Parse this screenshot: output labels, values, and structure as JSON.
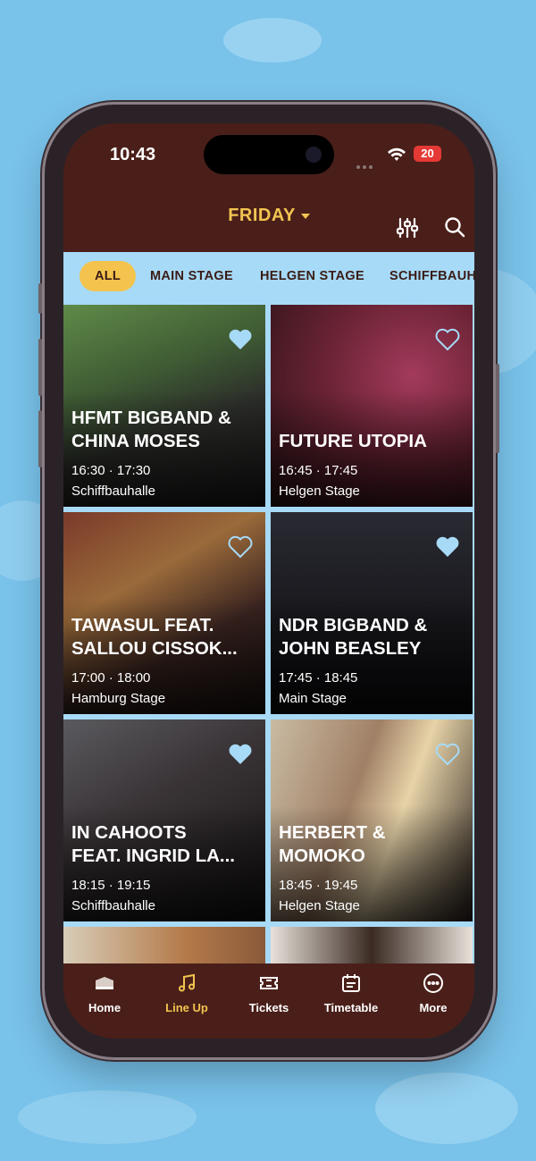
{
  "status": {
    "time": "10:43",
    "battery": "20"
  },
  "header": {
    "day": "FRIDAY"
  },
  "tabs": [
    {
      "label": "ALL",
      "active": true
    },
    {
      "label": "MAIN STAGE",
      "active": false
    },
    {
      "label": "HELGEN STAGE",
      "active": false
    },
    {
      "label": "SCHIFFBAUHALLE",
      "active": false
    }
  ],
  "events": [
    {
      "title": "HFMT BIGBAND &\nCHINA MOSES",
      "times": "16:30 · 17:30",
      "stage": "Schiffbauhalle",
      "favorited": true,
      "photo_tone": "#4d6a3c"
    },
    {
      "title": "FUTURE UTOPIA",
      "times": "16:45 · 17:45",
      "stage": "Helgen Stage",
      "favorited": false,
      "photo_tone": "#7a3346"
    },
    {
      "title": "TAWASUL FEAT.\nSALLOU CISSOK...",
      "times": "17:00 · 18:00",
      "stage": "Hamburg Stage",
      "favorited": false,
      "photo_tone": "#5a2a22"
    },
    {
      "title": "NDR BIGBAND &\nJOHN BEASLEY",
      "times": "17:45 · 18:45",
      "stage": "Main Stage",
      "favorited": true,
      "photo_tone": "#1a1a20"
    },
    {
      "title": "IN CAHOOTS\nFEAT. INGRID LA...",
      "times": "18:15 · 19:15",
      "stage": "Schiffbauhalle",
      "favorited": true,
      "photo_tone": "#3a3436"
    },
    {
      "title": "HERBERT &\nMOMOKO",
      "times": "18:45 · 19:45",
      "stage": "Helgen Stage",
      "favorited": false,
      "photo_tone": "#b9a88a"
    }
  ],
  "tabbar": [
    {
      "label": "Home",
      "icon": "home-icon",
      "active": false
    },
    {
      "label": "Line Up",
      "icon": "music-note-icon",
      "active": true
    },
    {
      "label": "Tickets",
      "icon": "ticket-icon",
      "active": false
    },
    {
      "label": "Timetable",
      "icon": "calendar-icon",
      "active": false
    },
    {
      "label": "More",
      "icon": "more-icon",
      "active": false
    }
  ],
  "colors": {
    "brand_brown": "#4a1f19",
    "accent_yellow": "#f2c451",
    "tab_strip": "#a7daf6",
    "heart": "#a7daf6"
  }
}
